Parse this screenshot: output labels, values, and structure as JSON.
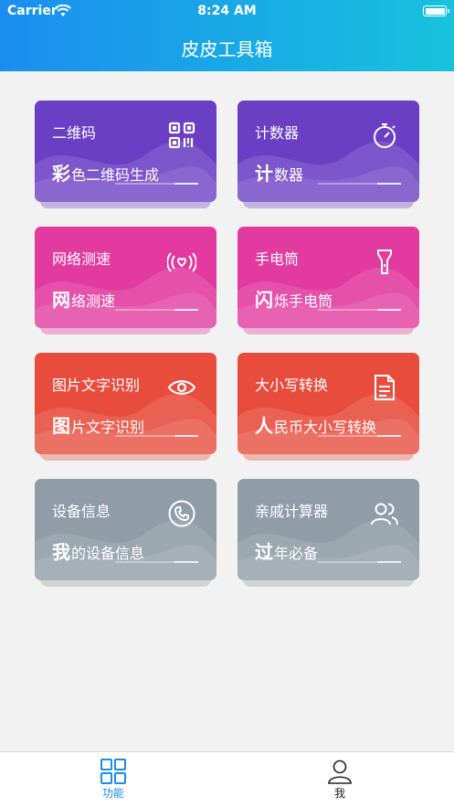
{
  "status": {
    "carrier": "Carrier",
    "time": "8:24 AM"
  },
  "header": {
    "title": "皮皮工具箱"
  },
  "cards": [
    {
      "title": "二维码",
      "sub_big": "彩",
      "sub_rest": "色二维码生成",
      "icon": "qr-code-icon",
      "color": "#6b3fc4"
    },
    {
      "title": "计数器",
      "sub_big": "计",
      "sub_rest": "数器",
      "icon": "stopwatch-icon",
      "color": "#6b3fc4"
    },
    {
      "title": "网络测速",
      "sub_big": "网",
      "sub_rest": "络测速",
      "icon": "signal-heart-icon",
      "color": "#e23a9e"
    },
    {
      "title": "手电筒",
      "sub_big": "闪",
      "sub_rest": "烁手电筒",
      "icon": "flashlight-icon",
      "color": "#e23a9e"
    },
    {
      "title": "图片文字识别",
      "sub_big": "图",
      "sub_rest": "片文字识别",
      "icon": "eye-icon",
      "color": "#e84c3d"
    },
    {
      "title": "大小写转换",
      "sub_big": "人",
      "sub_rest": "民币大小写转换",
      "icon": "document-icon",
      "color": "#e84c3d"
    },
    {
      "title": "设备信息",
      "sub_big": "我",
      "sub_rest": "的设备信息",
      "icon": "phone-icon",
      "color": "#8f9da6"
    },
    {
      "title": "亲戚计算器",
      "sub_big": "过",
      "sub_rest": "年必备",
      "icon": "people-icon",
      "color": "#8f9da6"
    }
  ],
  "tabs": {
    "home": "功能",
    "me": "我"
  },
  "colors": {
    "header_start": "#1a8ef0",
    "header_end": "#18c2dc",
    "tab_active": "#1a8ef0"
  }
}
